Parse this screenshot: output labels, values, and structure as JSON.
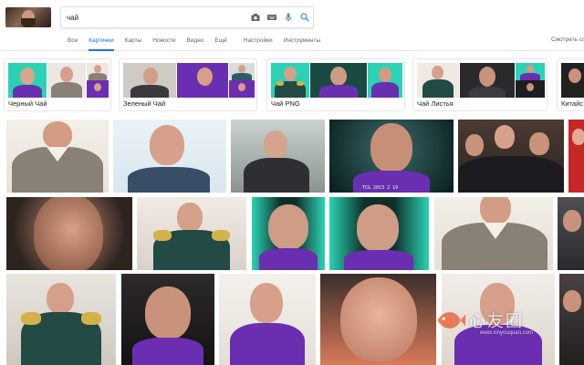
{
  "search": {
    "query": "чай",
    "icons": [
      "camera-icon",
      "keyboard-icon",
      "microphone-icon",
      "search-icon"
    ]
  },
  "tabs": [
    {
      "label": "Все",
      "active": false
    },
    {
      "label": "Картинки",
      "active": true
    },
    {
      "label": "Карты",
      "active": false
    },
    {
      "label": "Новости",
      "active": false
    },
    {
      "label": "Видео",
      "active": false
    },
    {
      "label": "Ещё",
      "active": false
    },
    {
      "label": "Настройки",
      "active": false
    },
    {
      "label": "Инструменты",
      "active": false
    }
  ],
  "tab_right": "Смотреть со",
  "chips": [
    {
      "label": "Черный Чай"
    },
    {
      "label": "Зеленый Чай"
    },
    {
      "label": "Чай PNG"
    },
    {
      "label": "Чай Листья"
    },
    {
      "label": "Китайс"
    }
  ],
  "overlay_text": "TCG 2013 2 19",
  "watermark": {
    "text": "心友圈",
    "url": "www.xinyouquan.com"
  },
  "colors": {
    "accent": "#1a73e8",
    "mic": "#4285f4",
    "purple": "#6a2fb0",
    "teal": "#2bd3b4",
    "skin": "#d79f86",
    "sweater": "#8a8176"
  }
}
